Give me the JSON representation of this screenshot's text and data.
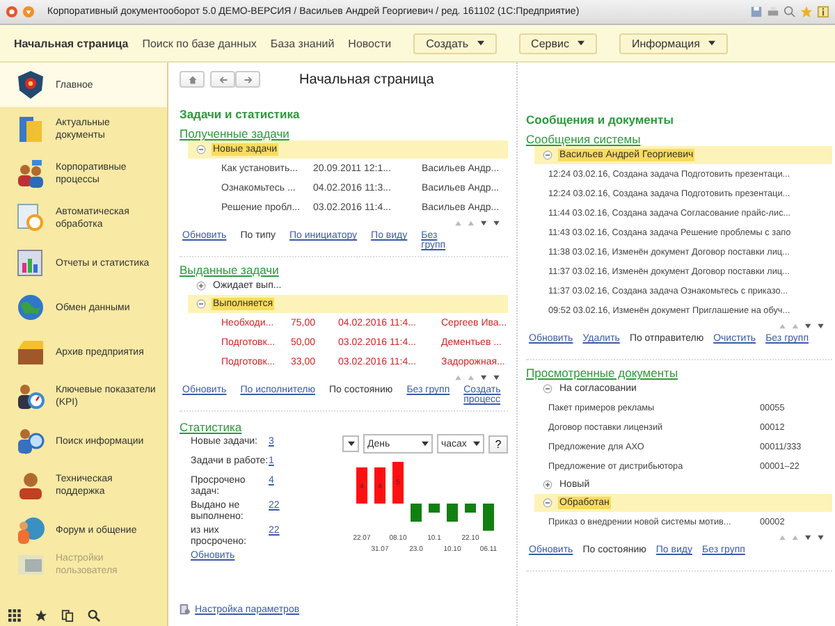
{
  "window": {
    "title": "Корпоративный документооборот 5.0 ДЕМО-ВЕРСИЯ / Васильев Андрей Георгиевич / ред. 161102  (1С:Предприятие)"
  },
  "menu": [
    {
      "label": "Начальная страница",
      "selected": true
    },
    {
      "label": "Поиск по базе данных",
      "selected": false
    },
    {
      "label": "База знаний",
      "selected": false
    },
    {
      "label": "Новости",
      "selected": false
    }
  ],
  "menu_dropdowns": [
    "Создать",
    "Сервис",
    "Информация"
  ],
  "sidebar": {
    "items": [
      {
        "label": "Главное",
        "selected": true,
        "disabled": false
      },
      {
        "label": "Актуальные документы",
        "selected": false,
        "disabled": false
      },
      {
        "label": "Корпоративные процессы",
        "selected": false,
        "disabled": false
      },
      {
        "label": "Автоматическая обработка",
        "selected": false,
        "disabled": false
      },
      {
        "label": "Отчеты и статистика",
        "selected": false,
        "disabled": false
      },
      {
        "label": "Обмен данными",
        "selected": false,
        "disabled": false
      },
      {
        "label": "Архив предприятия",
        "selected": false,
        "disabled": false
      },
      {
        "label": "Ключевые показатели (KPI)",
        "selected": false,
        "disabled": false
      },
      {
        "label": "Поиск информации",
        "selected": false,
        "disabled": false
      },
      {
        "label": "Техническая поддержка",
        "selected": false,
        "disabled": false
      },
      {
        "label": "Форум и общение",
        "selected": false,
        "disabled": false
      },
      {
        "label": "Настройки пользователя",
        "selected": false,
        "disabled": true
      }
    ]
  },
  "page_title": "Начальная страница",
  "left": {
    "title": "Задачи и статистика",
    "sections": [
      {
        "title": "Полученные задачи",
        "groups": [
          {
            "label": "Новые задачи",
            "expanded": true,
            "selected": true,
            "rows": [
              {
                "cells": [
                  "Как установить...",
                  "20.09.2011 12:1...",
                  "Васильев Андр..."
                ],
                "overdue": false
              },
              {
                "cells": [
                  "Ознакомьтесь ...",
                  "04.02.2016 11:3...",
                  "Васильев Андр..."
                ],
                "overdue": false
              },
              {
                "cells": [
                  "Решение пробл...",
                  "03.02.2016 11:4...",
                  "Васильев Андр..."
                ],
                "overdue": false
              }
            ]
          }
        ],
        "links": [
          {
            "label": "Обновить",
            "selected": false
          },
          {
            "label": "По типу",
            "selected": true
          },
          {
            "label": "По инициатору",
            "selected": false
          },
          {
            "label": "По виду",
            "selected": false
          },
          {
            "label": "Без групп",
            "selected": false
          }
        ]
      },
      {
        "title": "Выданные задачи",
        "groups": [
          {
            "label": "Ожидает вып...",
            "expanded": false,
            "selected": false
          },
          {
            "label": "Выполняется",
            "expanded": true,
            "selected": true,
            "rows": [
              {
                "cells": [
                  "Необходи...",
                  "75,00",
                  "04.02.2016 11:4...",
                  "Сергеев Ива..."
                ],
                "overdue": true
              },
              {
                "cells": [
                  "Подготовк...",
                  "50,00",
                  "03.02.2016 11:4...",
                  "Дементьев ..."
                ],
                "overdue": true
              },
              {
                "cells": [
                  "Подготовк...",
                  "33,00",
                  "03.02.2016 11:4...",
                  "Задорожная..."
                ],
                "overdue": true
              }
            ]
          }
        ],
        "links": [
          {
            "label": "Обновить",
            "selected": false
          },
          {
            "label": "По исполнителю",
            "selected": false
          },
          {
            "label": "По состоянию",
            "selected": true
          },
          {
            "label": "Без групп",
            "selected": false
          },
          {
            "label": "Создать процесс",
            "selected": false
          }
        ]
      }
    ]
  },
  "statistics": {
    "title": "Статистика",
    "items": [
      {
        "label": "Новые задачи:",
        "value": "3"
      },
      {
        "label": "Задачи в работе:",
        "value": "1"
      },
      {
        "label": "Просрочено задач:",
        "value": "4"
      },
      {
        "label": "Выдано не выполнено:",
        "value": "22"
      },
      {
        "label": "из них просрочено:",
        "value": "22"
      }
    ],
    "refresh": "Обновить",
    "period": "День",
    "unit": "часах",
    "help": "?",
    "chart_data": {
      "type": "bar",
      "categories": [
        "22.07",
        "31.07",
        "08.10",
        "23.0",
        "10.1",
        "10.10",
        "22.10",
        "06.11"
      ],
      "values": [
        4,
        4,
        5,
        -2,
        -1,
        -2,
        -1,
        -3
      ],
      "value_labels": [
        "4",
        "4",
        "5",
        null,
        null,
        null,
        null,
        null
      ]
    }
  },
  "settings_link": "Настройка параметров",
  "right": {
    "title": "Сообщения и документы",
    "sections": [
      {
        "title": "Сообщения системы",
        "groups": [
          {
            "label": "Васильев Андрей Георгиевич",
            "expanded": true,
            "selected": true,
            "rows": [
              {
                "cells": [
                  "12:24 03.02.16, Создана задача Подготовить презентаци..."
                ],
                "overdue": false
              },
              {
                "cells": [
                  "12:24 03.02.16, Создана задача Подготовить презентаци..."
                ],
                "overdue": false
              },
              {
                "cells": [
                  "11:44 03.02.16, Создана задача Согласование прайс-лис..."
                ],
                "overdue": false
              },
              {
                "cells": [
                  "11:43 03.02.16, Создана задача Решение проблемы с запо"
                ],
                "overdue": false
              },
              {
                "cells": [
                  "11:38 03.02.16, Изменён документ Договор поставки лиц..."
                ],
                "overdue": false
              },
              {
                "cells": [
                  "11:37 03.02.16, Изменён документ Договор поставки лиц..."
                ],
                "overdue": false
              },
              {
                "cells": [
                  "11:37 03.02.16, Создана задача Ознакомьтесь с приказо..."
                ],
                "overdue": false
              },
              {
                "cells": [
                  "09:52 03.02.16, Изменён документ Приглашение на обуч..."
                ],
                "overdue": false
              }
            ]
          }
        ],
        "links": [
          {
            "label": "Обновить",
            "selected": false
          },
          {
            "label": "Удалить",
            "selected": false
          },
          {
            "label": "По отправителю",
            "selected": true
          },
          {
            "label": "Очистить",
            "selected": false
          },
          {
            "label": "Без групп",
            "selected": false
          }
        ]
      },
      {
        "title": "Просмотренные документы",
        "groups": [
          {
            "label": "На согласовании",
            "expanded": true,
            "selected": false,
            "rows": [
              {
                "cells": [
                  "Пакет примеров рекламы",
                  "00055"
                ],
                "overdue": false
              },
              {
                "cells": [
                  "Договор поставки лицензий",
                  "00012"
                ],
                "overdue": false
              },
              {
                "cells": [
                  "Предложение для АХО",
                  "00011/333"
                ],
                "overdue": false
              },
              {
                "cells": [
                  "Предложение от дистрибьютора",
                  "00001–22"
                ],
                "overdue": false
              }
            ]
          },
          {
            "label": "Новый",
            "expanded": false,
            "selected": false
          },
          {
            "label": "Обработан",
            "expanded": true,
            "selected": true,
            "rows": [
              {
                "cells": [
                  "Приказ о внедрении новой системы мотив...",
                  "00002"
                ],
                "overdue": false
              }
            ]
          }
        ],
        "links": [
          {
            "label": "Обновить",
            "selected": false
          },
          {
            "label": "По состоянию",
            "selected": true
          },
          {
            "label": "По виду",
            "selected": false
          },
          {
            "label": "Без групп",
            "selected": false
          }
        ]
      }
    ]
  }
}
